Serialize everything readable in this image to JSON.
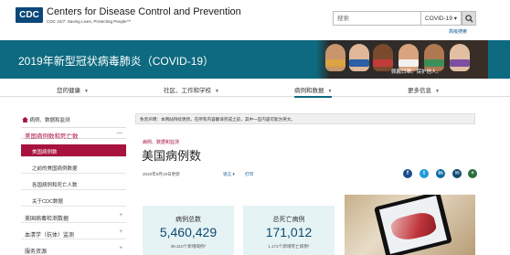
{
  "header": {
    "logo_text": "CDC",
    "org_name": "Centers for Disease Control and Prevention",
    "tagline": "CDC 24/7: Saving Lives, Protecting People™",
    "search_placeholder": "搜索",
    "search_scope": "COVID-19 ▾",
    "advanced_search": "高级搜索"
  },
  "banner": {
    "title": "2019年新型冠状病毒肺炎（COVID-19）",
    "caption": "佩戴口罩。保护他人。"
  },
  "nav": {
    "items": [
      {
        "label": "您的健康"
      },
      {
        "label": "社区、工作和学校"
      },
      {
        "label": "病例和数据"
      },
      {
        "label": "更多信息"
      }
    ]
  },
  "sidebar": {
    "breadcrumb": "病例、数据和监测",
    "section_title": "美国病例数和死亡数",
    "sub_items": [
      {
        "label": "美国病例数"
      },
      {
        "label": "之前的美国病例数据"
      },
      {
        "label": "各国病例和死亡人数"
      },
      {
        "label": "关于CDC数据"
      }
    ],
    "top_items": [
      {
        "label": "美国病毒检测数据"
      },
      {
        "label": "血清学（抗体）监测"
      },
      {
        "label": "服务资源"
      }
    ]
  },
  "main": {
    "disclaimer": "免责声明：本网站持续更新。在所有内容翻译完成之前，其中一些内容可能为英文。",
    "breadcrumb": "病例、数据和监测",
    "title": "美国病例数",
    "date": "2020年8月19日更新",
    "language": "语言 ▾",
    "print": "打印",
    "stats": [
      {
        "label": "病例总数",
        "value": "5,460,429",
        "sub": "39,310个新增病例*"
      },
      {
        "label": "总死亡病例",
        "value": "171,012",
        "sub": "1,172个新增死亡病例*"
      }
    ]
  },
  "colors": {
    "brand_teal": "#0d6a80",
    "accent_red": "#a8123e",
    "stat_bg": "#e6f3f5"
  },
  "icons": {
    "search": "search-icon",
    "home": "home-icon",
    "social": [
      "facebook-icon",
      "twitter-icon",
      "linkedin-icon",
      "email-icon",
      "syndicate-icon"
    ]
  }
}
